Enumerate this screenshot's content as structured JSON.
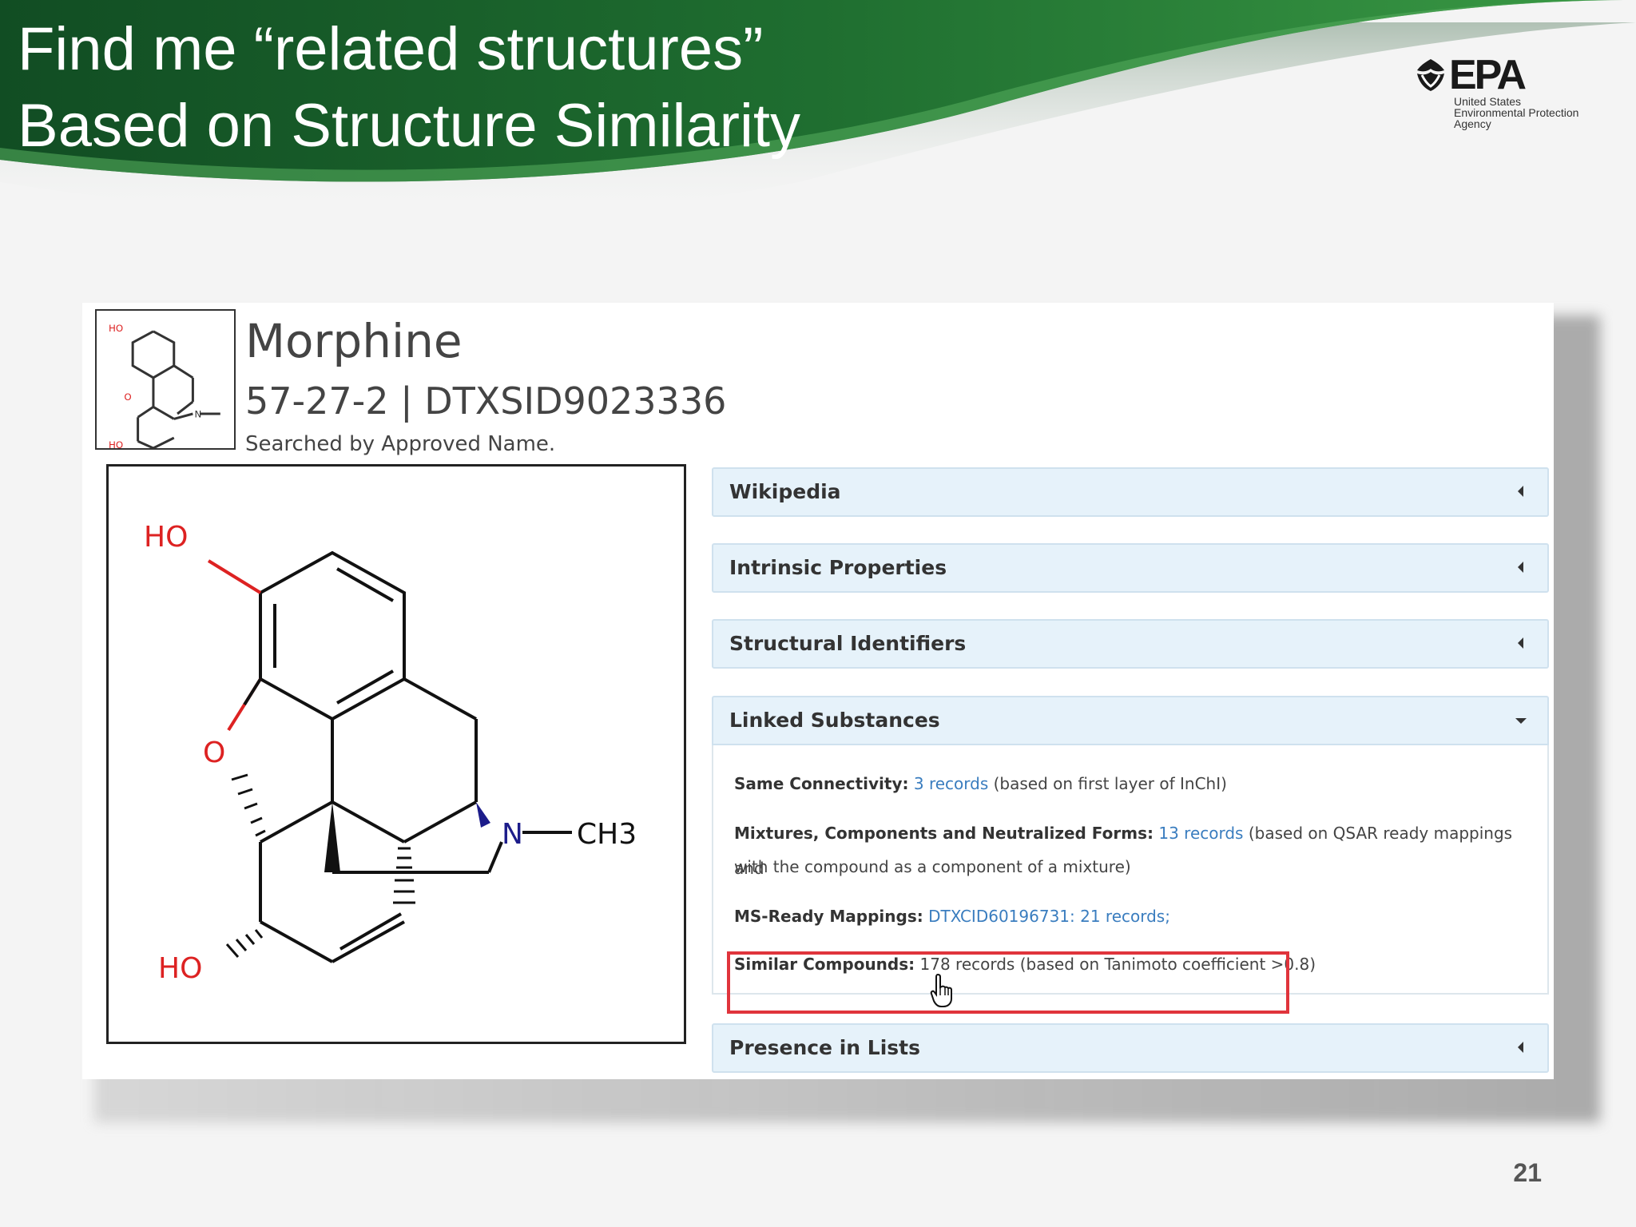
{
  "slide": {
    "title_line1": "Find me “related structures”",
    "title_line2": "Based on Structure Similarity",
    "page_number": "21",
    "colors": {
      "banner_dark": "#15562a",
      "banner_mid": "#2f8a3a",
      "highlight": "#e0343c"
    }
  },
  "logo": {
    "word": "EPA",
    "sub_line1": "United States",
    "sub_line2": "Environmental Protection",
    "sub_line3": "Agency"
  },
  "compound": {
    "name": "Morphine",
    "ids": "57-27-2 | DTXSID9023336",
    "search_note": "Searched by Approved Name.",
    "structure_labels": {
      "ho_top": "HO",
      "o_ring": "O",
      "n": "N",
      "ch3": "CH3",
      "ho_bottom": "HO"
    }
  },
  "panels": {
    "wikipedia": "Wikipedia",
    "intrinsic": "Intrinsic Properties",
    "structural": "Structural Identifiers",
    "linked": "Linked Substances",
    "presence": "Presence in Lists"
  },
  "linked": {
    "same_connectivity": {
      "label": "Same Connectivity:",
      "link": "3 records",
      "text": " (based on first layer of InChI)"
    },
    "mixtures": {
      "label": "Mixtures, Components and Neutralized Forms:",
      "link": "13 records",
      "text": " (based on QSAR ready mappings and",
      "text2": "with the compound as a component of a mixture)"
    },
    "ms_ready": {
      "label": "MS-Ready Mappings:",
      "link": "DTXCID60196731: 21 records;"
    },
    "similar": {
      "label": "Similar Compounds:",
      "text": " 178 records (based on Tanimoto coefficient >0.8)"
    }
  }
}
